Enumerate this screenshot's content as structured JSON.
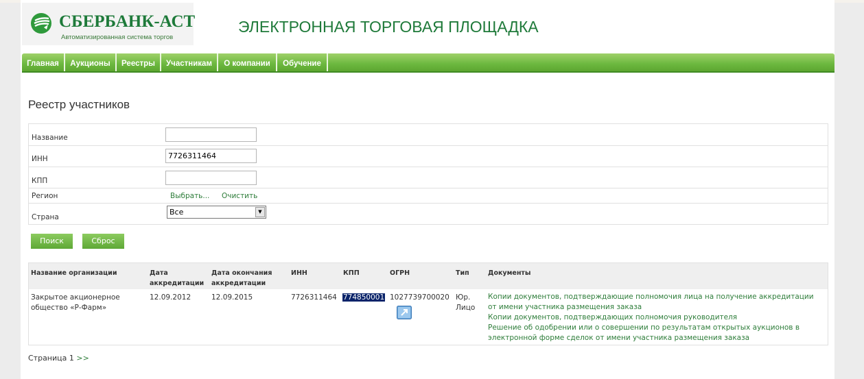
{
  "header": {
    "logo_name": "СБЕРБАНК-АСТ",
    "logo_subtitle": "Автоматизированная система торгов",
    "site_title": "ЭЛЕКТРОННАЯ ТОРГОВАЯ ПЛОЩАДКА"
  },
  "nav": {
    "items": [
      {
        "label": "Главная"
      },
      {
        "label": "Аукционы"
      },
      {
        "label": "Реестры"
      },
      {
        "label": "Участникам"
      },
      {
        "label": "О компании"
      },
      {
        "label": "Обучение"
      }
    ]
  },
  "registry": {
    "title": "Реестр участников",
    "filters": {
      "name_label": "Название",
      "name_value": "",
      "inn_label": "ИНН",
      "inn_value": "7726311464",
      "kpp_label": "КПП",
      "kpp_value": "",
      "region_label": "Регион",
      "region_select": "Выбрать...",
      "region_clear": "Очистить",
      "country_label": "Страна",
      "country_value": "Все"
    },
    "buttons": {
      "search": "Поиск",
      "reset": "Сброс"
    }
  },
  "results": {
    "headers": {
      "org": "Название организации",
      "acc_date": "Дата аккредитации",
      "acc_end": "Дата окончания аккредитации",
      "inn": "ИНН",
      "kpp": "КПП",
      "ogrn": "ОГРН",
      "type": "Тип",
      "docs": "Документы"
    },
    "rows": [
      {
        "org": "Закрытое акционерное общество «Р-Фарм»",
        "acc_date": "12.09.2012",
        "acc_end": "12.09.2015",
        "inn": "7726311464",
        "kpp": "774850001",
        "ogrn": "1027739700020",
        "type": "Юр. Лицо",
        "docs": [
          "Копии документов, подтверждающие полномочия лица на получение аккредитации от имени участника размещения заказа",
          "Копии документов, подтверждающих полномочия руководителя",
          "Решение об одобрении или о совершении по результатам открытых аукционов в электронной форме сделок от имени участника размещения заказа"
        ]
      }
    ]
  },
  "pager": {
    "label": "Страница 1",
    "next": ">>"
  }
}
